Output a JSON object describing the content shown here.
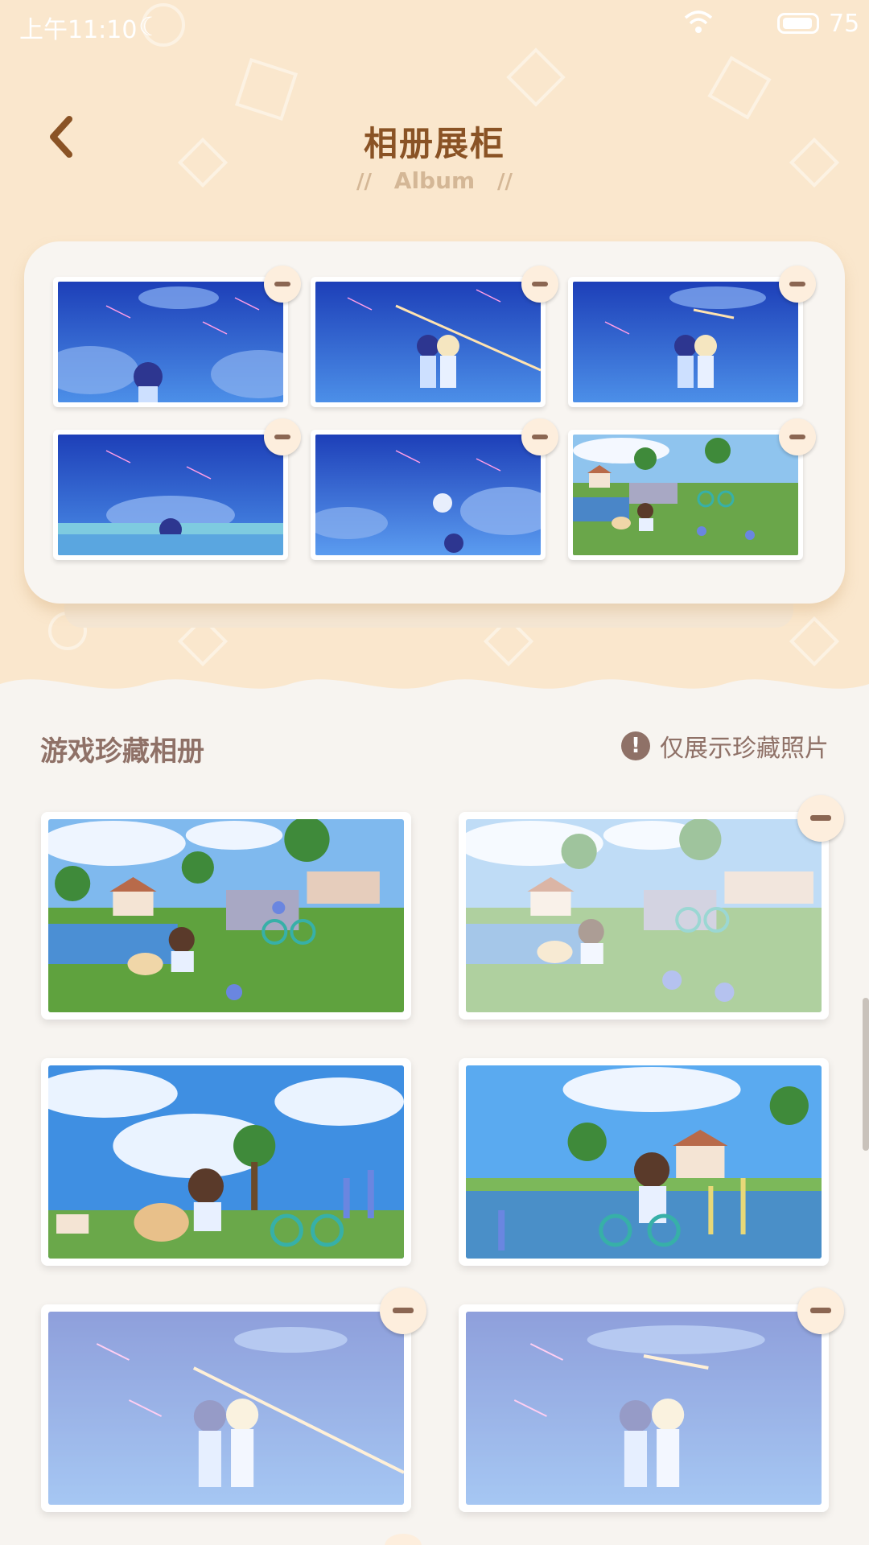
{
  "status_bar": {
    "time": "上午11:10",
    "battery_level": "75"
  },
  "header": {
    "title": "相册展柜",
    "subtitle": "Album",
    "subtitle_dash": "//"
  },
  "showcase": {
    "photos": [
      {
        "scene": "night-sky-one-kid"
      },
      {
        "scene": "night-sky-two-kids"
      },
      {
        "scene": "night-sky-two-kids-close"
      },
      {
        "scene": "night-sky-rooftop"
      },
      {
        "scene": "night-sky-moon"
      },
      {
        "scene": "meadow-bunny"
      }
    ]
  },
  "album": {
    "title": "游戏珍藏相册",
    "notice": "仅展示珍藏照片",
    "photos": [
      {
        "scene": "meadow-bunny",
        "in_showcase": false,
        "faded": false
      },
      {
        "scene": "meadow-bunny",
        "in_showcase": true,
        "faded": true
      },
      {
        "scene": "girl-with-bunny",
        "in_showcase": false,
        "faded": false
      },
      {
        "scene": "kid-with-bike",
        "in_showcase": false,
        "faded": false
      },
      {
        "scene": "night-sky-two-kids",
        "in_showcase": true,
        "faded": true
      },
      {
        "scene": "night-sky-two-kids-close",
        "in_showcase": true,
        "faded": true
      }
    ]
  },
  "colors": {
    "header_bg": "#fae7cd",
    "page_bg": "#f7f4f0",
    "title": "#8a5325",
    "subtitle": "#d4b796",
    "section_text": "#8f7167",
    "remove_button": "#fdeedd"
  }
}
